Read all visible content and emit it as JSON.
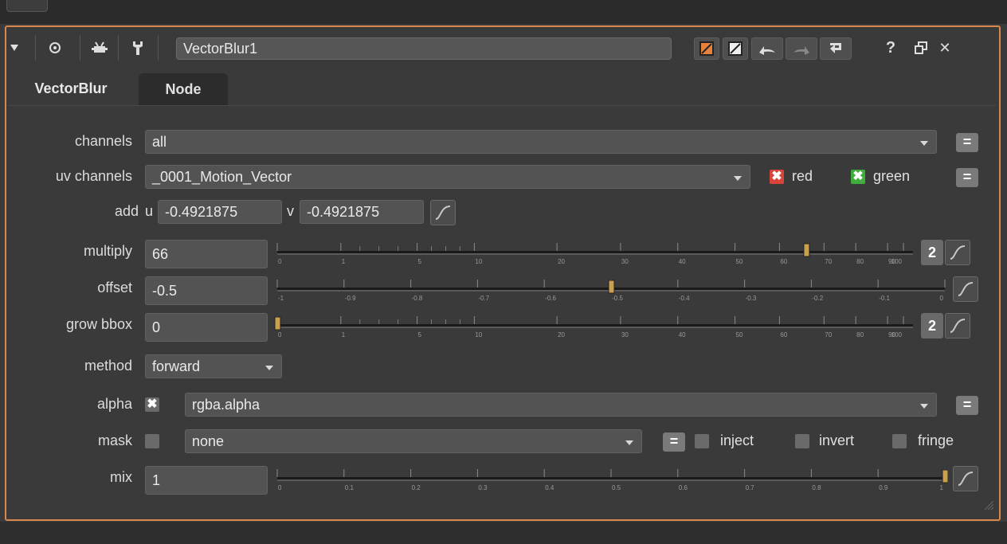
{
  "node_title": "VectorBlur1",
  "header_icons": [
    "collapse-triangle-icon",
    "viewer-circle-icon",
    "fly-icon",
    "wrench-icon",
    "red-color-icon",
    "white-color-icon",
    "undo-icon",
    "redo-icon",
    "revert-icon",
    "help-icon",
    "float-icon",
    "close-icon"
  ],
  "header_text": {
    "help": "?",
    "close": "✕"
  },
  "tabs": [
    {
      "label": "VectorBlur",
      "active": true
    },
    {
      "label": "Node",
      "active": false
    }
  ],
  "rows": {
    "channels": {
      "label": "channels",
      "value": "all",
      "eq": "="
    },
    "uv_channels": {
      "label": "uv channels",
      "value": "_0001_Motion_Vector",
      "red_label": "red",
      "green_label": "green",
      "eq": "="
    },
    "add": {
      "label": "add",
      "u_label": "u",
      "u_value": "-0.4921875",
      "v_label": "v",
      "v_value": "-0.4921875"
    },
    "multiply": {
      "label": "multiply",
      "value": "66",
      "badge": "2",
      "slider_value": 66
    },
    "offset": {
      "label": "offset",
      "value": "-0.5",
      "slider_value": -0.5
    },
    "grow_bbox": {
      "label": "grow bbox",
      "value": "0",
      "badge": "2",
      "slider_value": 0
    },
    "method": {
      "label": "method",
      "value": "forward"
    },
    "alpha": {
      "label": "alpha",
      "value": "rgba.alpha",
      "checked_mark": "✖",
      "eq": "="
    },
    "mask": {
      "label": "mask",
      "value": "none",
      "eq": "=",
      "inject_label": "inject",
      "invert_label": "invert",
      "fringe_label": "fringe"
    },
    "mix": {
      "label": "mix",
      "value": "1",
      "slider_value": 1
    }
  },
  "scales": {
    "log": [
      "0",
      "1",
      "5",
      "10",
      "20",
      "30",
      "40",
      "50",
      "60",
      "70",
      "80",
      "90",
      "100"
    ],
    "offset": [
      "-1",
      "-0.9",
      "-0.8",
      "-0.7",
      "-0.6",
      "-0.5",
      "-0.4",
      "-0.3",
      "-0.2",
      "-0.1",
      "0"
    ],
    "mix": [
      "0",
      "0.1",
      "0.2",
      "0.3",
      "0.4",
      "0.5",
      "0.6",
      "0.7",
      "0.8",
      "0.9",
      "1"
    ]
  },
  "colors": {
    "accent": "#d9874a",
    "red_check": "#d8443a",
    "green_check": "#3fae3f",
    "handle": "#c9a050"
  }
}
